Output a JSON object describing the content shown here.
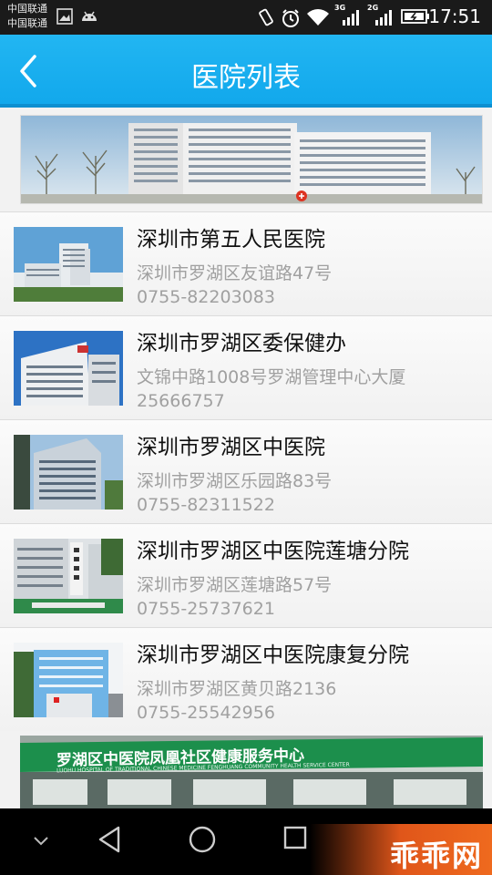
{
  "status_bar": {
    "carrier_1": "中国联通",
    "carrier_2": "中国联通",
    "net_1": "3G",
    "net_2": "2G",
    "time": "17:51"
  },
  "header": {
    "title": "医院列表",
    "back_icon": "chevron-left-icon"
  },
  "hospitals": [
    {
      "name": "深圳市第五人民医院",
      "address": "深圳市罗湖区友谊路47号",
      "phone": "0755-82203083"
    },
    {
      "name": "深圳市罗湖区委保健办",
      "address": "文锦中路1008号罗湖管理中心大厦",
      "phone": "25666757"
    },
    {
      "name": "深圳市罗湖区中医院",
      "address": "深圳市罗湖区乐园路83号",
      "phone": "0755-82311522"
    },
    {
      "name": "深圳市罗湖区中医院莲塘分院",
      "address": "深圳市罗湖区莲塘路57号",
      "phone": "0755-25737621"
    },
    {
      "name": "深圳市罗湖区中医院康复分院",
      "address": "深圳市罗湖区黄贝路2136",
      "phone": "0755-25542956"
    }
  ],
  "bottom_banner": {
    "sign_text": "罗湖区中医院凤凰社区健康服务中心",
    "sign_subtext": "LUOHU HOSPITAL OF TRADITIONAL CHINESE MEDICINE FENGHUANG COMMUNITY HEALTH SERVICE CENTER"
  },
  "watermark": "乖乖网",
  "colors": {
    "header": "#1aaeee",
    "status_bar": "#1a1a1a",
    "nav_bar": "#000000"
  }
}
